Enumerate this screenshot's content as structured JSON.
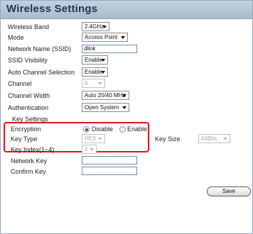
{
  "title": "Wireless Settings",
  "fields": {
    "wireless_band": {
      "label": "Wireless Band",
      "value": "2.4GHz"
    },
    "mode": {
      "label": "Mode",
      "value": "Access Point"
    },
    "ssid": {
      "label": "Network Name (SSID)",
      "value": "dlink"
    },
    "ssid_visibility": {
      "label": "SSID Visibility",
      "value": "Enable"
    },
    "auto_channel": {
      "label": "Auto Channel Selection",
      "value": "Enable"
    },
    "channel": {
      "label": "Channel",
      "value": "6"
    },
    "channel_width": {
      "label": "Channel Width",
      "value": "Auto 20/40 MHz"
    },
    "authentication": {
      "label": "Authentication",
      "value": "Open System"
    }
  },
  "key_settings": {
    "heading": "Key Settings",
    "encryption": {
      "label": "Encryption",
      "options": [
        "Disable",
        "Enable"
      ],
      "selected": "Disable"
    },
    "key_type": {
      "label": "Key Type",
      "value": "HEX"
    },
    "key_size": {
      "label": "Key Size",
      "value": "64Bits"
    },
    "key_index": {
      "label": "Key Index(1~4)",
      "value": "1"
    },
    "network_key": {
      "label": "Network Key",
      "value": ""
    },
    "confirm_key": {
      "label": "Confirm Key",
      "value": ""
    }
  },
  "buttons": {
    "save": "Save"
  },
  "colors": {
    "highlight_border": "#e0151d",
    "title_text": "#1f3550",
    "title_bar": "#b6c6d6"
  }
}
